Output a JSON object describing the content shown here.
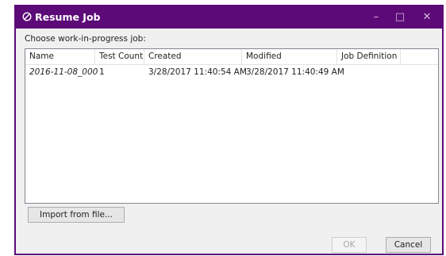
{
  "window": {
    "title": "Resume Job",
    "title_icon": "circle-slash-icon",
    "controls": {
      "minimize": "–",
      "maximize": "□",
      "close": "✕"
    },
    "accent_color": "#5c0a78"
  },
  "prompt": "Choose work-in-progress job:",
  "table": {
    "columns": [
      "Name",
      "Test Count",
      "Created",
      "Modified",
      "Job Definition"
    ],
    "rows": [
      [
        "2016-11-08_000",
        "1",
        "3/28/2017 11:40:54 AM",
        "3/28/2017 11:40:49 AM",
        ""
      ]
    ]
  },
  "buttons": {
    "import": "Import from file...",
    "ok": "OK",
    "cancel": "Cancel"
  }
}
